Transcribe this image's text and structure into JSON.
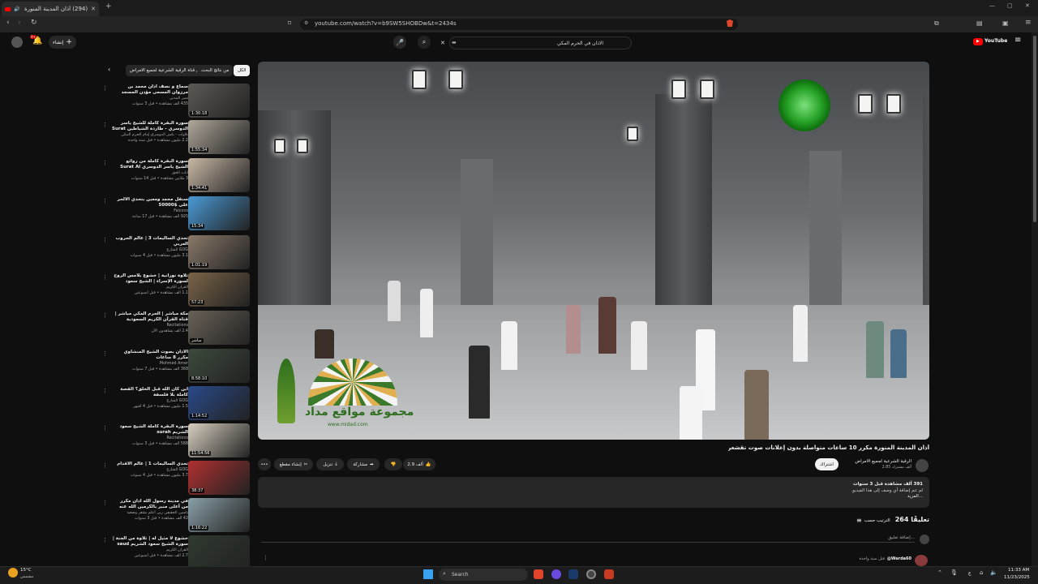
{
  "browser": {
    "tab_title": "(294) أذان المدينة المنورة مكرر",
    "url": "youtube.com/watch?v=b9SW5SHOBDw&t=2434s",
    "new_tab": "+",
    "window_min": "—",
    "window_max": "▢",
    "window_close": "✕"
  },
  "youtube": {
    "create_label": "إنشاء",
    "notif_count": "9+",
    "search_value": "الاذان في الحرم المكي",
    "chips": [
      "الكل",
      "من نتائج البحث",
      "من قناة الرقية الشرعية لجميع الامراض"
    ],
    "video_title": "أذان المدينة المنورة مكرر 10 ساعات متواصلة بدون إعلانات صوت تقشعر له الابدان",
    "channel_name": "الرقية الشرعية لجميع الامراض",
    "subscribers": "2.85 ألف مشترك",
    "join_label": "اشتراك",
    "likes": "2.9 ألف",
    "share_label": "مشاركة",
    "download_label": "تنزيل",
    "clip_label": "إنشاء مقطع",
    "more_label": "•••",
    "desc_stats": "391 ألف مشاهدة قبل 3 سنوات",
    "desc_text": "لم تتم إضافة أي وصف إلى هذا الفيديو.",
    "desc_more": "...المزيد",
    "comments_count": "264 تعليقًا",
    "sort_label": "الترتيب حسب",
    "add_comment": "إضافة تعليق...",
    "first_commenter": "@Warda60",
    "first_comment_time": "قبل سنة واحدة",
    "watermark_text": "مجموعة مواقع مداد",
    "watermark_url": "www.midad.com"
  },
  "recommendations": [
    {
      "title": "سماع و نصف أذان محمد بن مرزوان المسعى مؤذن المسجد النبوي الشريف",
      "channel": "سير المدني",
      "stats": "435 ألف مشاهدة • قبل 3 سنوات",
      "duration": "1:30:18",
      "thumb": "#5c5a55"
    },
    {
      "title": "سورة البقرة كاملة للشيخ ياسر الدوسري - طاردة الشياطين Surat Al Baqarah",
      "channel": "تلاوات - ياسر الدوسري إمام الحرم المكي",
      "stats": "2.2 مليون مشاهدة • قبل سنة واحدة",
      "duration": "1:55:34",
      "thumb": "#b0a79a"
    },
    {
      "title": "سورة البقرة كاملة من روائع الشيخ ياسر الدوسري Surat Al",
      "channel": "آيات الحق",
      "stats": "3 ملايين مشاهدة • قبل 14 سنوات",
      "duration": "1:34:41",
      "thumb": "#c9b9a6"
    },
    {
      "title": "سنقل محمد ومعين بتحدي الالحر على $50000",
      "channel": "Falcons",
      "stats": "925 ألف مشاهدة • قبل 17 ساعة",
      "duration": "15:34",
      "thumb": "#4a9ad6"
    },
    {
      "title": "تحدي الساليمات 3 | عالم الحروب العربي",
      "channel": "GOG الشارع",
      "stats": "3.1 مليون مشاهدة • قبل 4 سنوات",
      "duration": "1:01:19",
      "thumb": "#8a7a6a"
    },
    {
      "title": "تلاوة نورانية | خشوع بلامس الروح لسورة الإسراء | الشيخ سعود الشريم",
      "channel": "القرآن الكريم",
      "stats": "1.1 ألف مشاهدة • قبل أسبوعين",
      "duration": "57:23",
      "thumb": "#7a6448"
    },
    {
      "title": "مكة مباشر | الحرم المكي مباشر | قناة القرآن الكريم السعودية Makkah Live",
      "channel": "Recitations",
      "stats": "2.4 ألف يشاهدون الآن",
      "duration": "مباشر",
      "thumb": "#6a6258"
    },
    {
      "title": "الأذان بصوت الشيخ المنشاوي مكرر 8 ساعات",
      "channel": "Mohmed Amer",
      "stats": "368 ألف مشاهدة • قبل 7 سنوات",
      "duration": "8:58:10",
      "thumb": "#3c4a3c"
    },
    {
      "title": "أين كان الله قبل الخلق؟ القصة كاملة بلا فلسفة",
      "channel": "GOG الشارع",
      "stats": "1.5 مليون مشاهدة • قبل 4 أشهر",
      "duration": "1:14:52",
      "thumb": "#2a4a8a"
    },
    {
      "title": "سورة البقرة كاملة الشيخ سعود الشريم surah",
      "channel": "Recitations",
      "stats": "588 ألف مشاهدة • قبل 3 سنوات",
      "duration": "11:54:56",
      "thumb": "#d8cfc0"
    },
    {
      "title": "تحدي الساليمات 1 | عالم الأقدام",
      "channel": "GOG الشارع",
      "stats": "3.7 مليون مشاهدة • قبل 4 سنوات",
      "duration": "38:37",
      "thumb": "#b03030"
    },
    {
      "title": "في مدينة رسول الله أذان مكرر من أعلى منبر بالكرمين الله عنه",
      "channel": "ياسين الحقيقي ربي أعلم يشعر وضعية",
      "stats": "42 ألف مشاهدة • قبل 3 سنوات",
      "duration": "1:16:22",
      "thumb": "#8aa0a8"
    },
    {
      "title": "خشوع لا مثيل له | تلاوة من الجنة | سورة الشيخ سعود الشريم saud",
      "channel": "القرآن الكريم",
      "stats": "2.7 ألف مشاهدة • قبل أسبوعين",
      "duration": "",
      "thumb": "#2f3a2f"
    }
  ],
  "taskbar": {
    "search_placeholder": "Search",
    "weather_temp": "15°C",
    "weather_desc": "مشمس",
    "time": "11:33 AM",
    "date": "11/23/2025",
    "lang": "ع"
  }
}
